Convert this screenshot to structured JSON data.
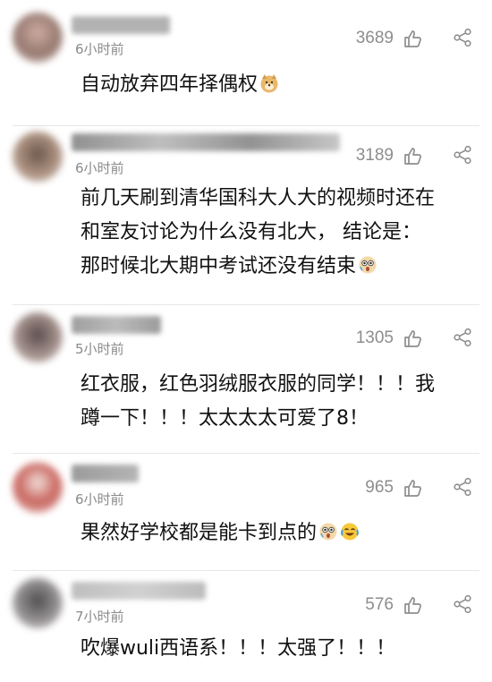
{
  "comments": [
    {
      "time": "6小时前",
      "likes": "3689",
      "lines": [
        "自动放弃四年择偶权"
      ],
      "emojis": [
        "doge-emoji"
      ],
      "avatar_color": "#b08a7a",
      "username_color": "#9a9a9a"
    },
    {
      "time": "6小时前",
      "likes": "3189",
      "lines": [
        "前几天刷到清华国科大人大的视频时还在",
        "和室友讨论为什么没有北大， 结论是：",
        "那时候北大期中考试还没有结束"
      ],
      "emojis": [
        "shocked-face-emoji"
      ],
      "avatar_color": "#8a6c5c",
      "username_color": "#8f8f8f"
    },
    {
      "time": "5小时前",
      "likes": "1305",
      "lines": [
        "红衣服，红色羽绒服衣服的同学！！！我",
        "蹲一下！！！太太太太可爱了8！"
      ],
      "emojis": [],
      "avatar_color": "#7c6a66",
      "username_color": "#969696"
    },
    {
      "time": "6小时前",
      "likes": "965",
      "lines": [
        "果然好学校都是能卡到点的"
      ],
      "emojis": [
        "shocked-face-emoji",
        "crying-laughing-emoji"
      ],
      "avatar_color": "#b24d48",
      "username_color": "#8c8c8c"
    },
    {
      "time": "7小时前",
      "likes": "576",
      "lines": [
        "吹爆wuli西语系！！！太强了！！！"
      ],
      "emojis": [],
      "avatar_color": "#6e6a6c",
      "username_color": "#a3a3a3"
    }
  ]
}
